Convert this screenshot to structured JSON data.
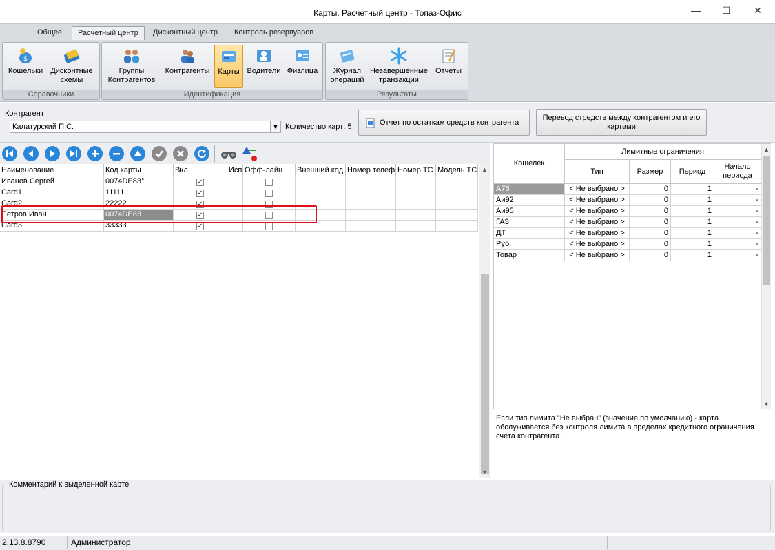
{
  "window": {
    "title": "Карты. Расчетный центр - Топаз-Офис",
    "minimize": "—",
    "maximize": "☐",
    "close": "✕"
  },
  "ribbon_tabs": [
    "Общее",
    "Расчетный центр",
    "Дисконтный центр",
    "Контроль резервуаров"
  ],
  "active_tab": "Расчетный центр",
  "ribbon_groups": [
    {
      "caption": "Справочники",
      "buttons": [
        {
          "label": "Кошельки",
          "icon": "wallet-icon"
        },
        {
          "label": "Дисконтные схемы",
          "icon": "discount-card-icon"
        }
      ]
    },
    {
      "caption": "Идентификация",
      "buttons": [
        {
          "label": "Группы Контрагентов",
          "icon": "group-users-icon"
        },
        {
          "label": "Контрагенты",
          "icon": "users-icon"
        },
        {
          "label": "Карты",
          "icon": "cards-icon",
          "active": true
        },
        {
          "label": "Водители",
          "icon": "driver-icon"
        },
        {
          "label": "Физлица",
          "icon": "person-card-icon"
        }
      ]
    },
    {
      "caption": "Результаты",
      "buttons": [
        {
          "label": "Журнал операций",
          "icon": "journal-icon"
        },
        {
          "label": "Незавершенные транзакции",
          "icon": "snowflake-icon"
        },
        {
          "label": "Отчеты",
          "icon": "report-icon"
        }
      ]
    }
  ],
  "contragent": {
    "label": "Контрагент",
    "value": "Калатурский П.С.",
    "cards_count_label": "Количество карт: 5",
    "report_button": "Отчет по остаткам средств контрагента",
    "transfer_button": "Перевод стредств между контрагентом и его картами"
  },
  "grid": {
    "columns": [
      "Наименование",
      "Код карты",
      "Вкл.",
      "Исп",
      "Офф-лайн",
      "Внешний код",
      "Номер телеф",
      "Номер ТС",
      "Модель ТС"
    ],
    "rows": [
      {
        "name": "Иванов Сергей",
        "code": "0074DE83°",
        "enabled": true,
        "offline": false
      },
      {
        "name": "Card1",
        "code": "11111",
        "enabled": true,
        "offline": false
      },
      {
        "name": "Card2",
        "code": "22222",
        "enabled": true,
        "offline": false
      },
      {
        "name": "Петров Иван",
        "code": "0074DE83",
        "enabled": true,
        "offline": false,
        "selected": true
      },
      {
        "name": "Card3",
        "code": "33333",
        "enabled": true,
        "offline": false
      }
    ]
  },
  "limits": {
    "col_wallet": "Кошелек",
    "group_header": "Лимитные ограничения",
    "col_type": "Тип",
    "col_size": "Размер",
    "col_period": "Период",
    "col_start": "Начало периода",
    "rows": [
      {
        "wallet": "А76",
        "type": "< Не выбрано >",
        "size": "0",
        "period": "1",
        "start": "-"
      },
      {
        "wallet": "Аи92",
        "type": "< Не выбрано >",
        "size": "0",
        "period": "1",
        "start": "-"
      },
      {
        "wallet": "Аи95",
        "type": "< Не выбрано >",
        "size": "0",
        "period": "1",
        "start": "-"
      },
      {
        "wallet": "ГАЗ",
        "type": "< Не выбрано >",
        "size": "0",
        "period": "1",
        "start": "-"
      },
      {
        "wallet": "ДТ",
        "type": "< Не выбрано >",
        "size": "0",
        "period": "1",
        "start": "-"
      },
      {
        "wallet": "Руб.",
        "type": "< Не выбрано >",
        "size": "0",
        "period": "1",
        "start": "-"
      },
      {
        "wallet": "Товар",
        "type": "< Не выбрано >",
        "size": "0",
        "period": "1",
        "start": "-"
      }
    ],
    "note": "Если тип лимита \"Не выбран\" (значение по умолчанию) - карта обслуживается без контроля лимита в пределах кредитного ограничения счета контрагента."
  },
  "comment_label": "Комментарий к выделенной карте",
  "status": {
    "version": "2.13.8.8790",
    "user": "Администратор"
  },
  "colors": {
    "highlight_red": "#e0101a",
    "active_ribbon": "#fbc86a",
    "selected_cell": "#8c8c8c"
  }
}
